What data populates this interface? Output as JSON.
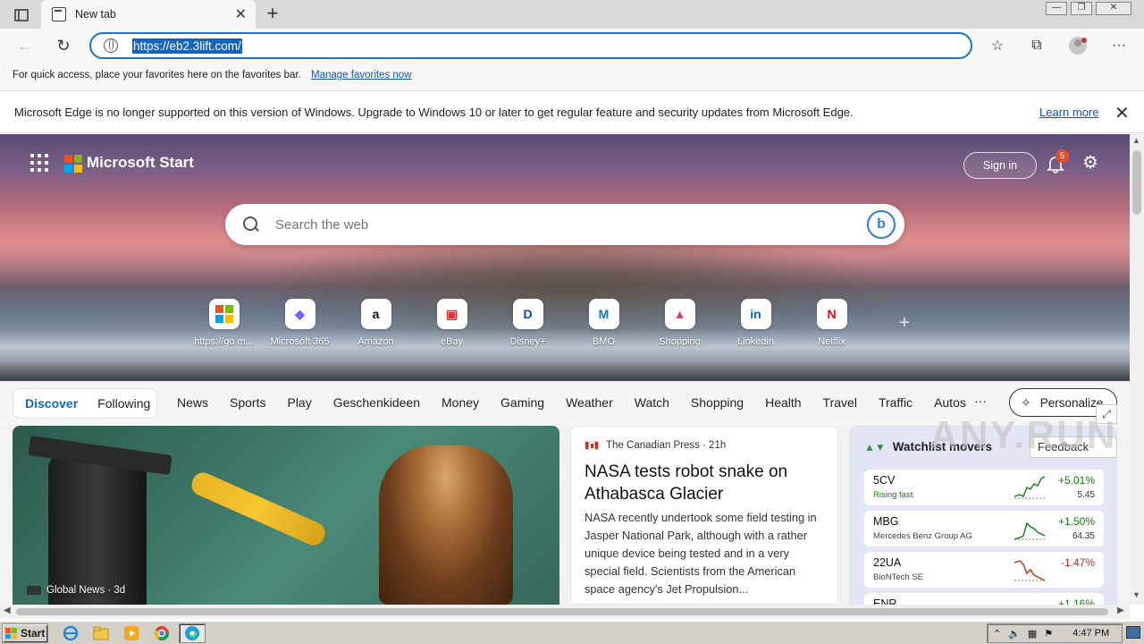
{
  "browser": {
    "tab_title": "New tab",
    "address_url": "https://eb2.3lift.com/",
    "favorites_bar_text": "For quick access, place your favorites here on the favorites bar.",
    "favorites_bar_link": "Manage favorites now",
    "infobar_text": "Microsoft Edge is no longer supported on this version of Windows. Upgrade to Windows 10 or later to get regular feature and security updates from Microsoft Edge.",
    "infobar_link": "Learn more"
  },
  "start": {
    "brand": "Microsoft Start",
    "sign_in": "Sign in",
    "notification_count": "5",
    "search_placeholder": "Search the web",
    "bing_label": "b",
    "quick_links": [
      {
        "label": "https://go.m...",
        "glyph": "",
        "color": "#f25022"
      },
      {
        "label": "Microsoft 365",
        "glyph": "◆",
        "color": "#7b61ff"
      },
      {
        "label": "Amazon",
        "glyph": "a",
        "color": "#111111"
      },
      {
        "label": "eBay",
        "glyph": "▣",
        "color": "#e53238"
      },
      {
        "label": "Disney+",
        "glyph": "D",
        "color": "#113ccf"
      },
      {
        "label": "BMO",
        "glyph": "M",
        "color": "#0079c1"
      },
      {
        "label": "Shopping",
        "glyph": "▲",
        "color": "#e9356e"
      },
      {
        "label": "Linkedin",
        "glyph": "in",
        "color": "#0a66c2"
      },
      {
        "label": "Netflix",
        "glyph": "N",
        "color": "#e50914"
      }
    ]
  },
  "feed_nav": {
    "discover": "Discover",
    "following": "Following",
    "tabs": [
      "News",
      "Sports",
      "Play",
      "Geschenkideen",
      "Money",
      "Gaming",
      "Weather",
      "Watch",
      "Shopping",
      "Health",
      "Travel",
      "Traffic",
      "Autos"
    ],
    "more": "···",
    "personalize": "Personalize"
  },
  "hero_card": {
    "source": "Global News · 3d"
  },
  "news_card": {
    "source": "The Canadian Press · 21h",
    "title": "NASA tests robot snake on Athabasca Glacier",
    "body": "NASA recently undertook some field testing in Jasper National Park, although with a rather unique device being tested and in a very special field. Scientists from the American space agency's Jet Propulsion..."
  },
  "watchlist": {
    "title": "Watchlist movers",
    "more": "···",
    "rows": [
      {
        "symbol": "5CV",
        "name": "Rising fast",
        "change": "+5.01%",
        "value": "5.45",
        "direction": "up"
      },
      {
        "symbol": "MBG",
        "name": "Mercedes Benz Group AG",
        "change": "+1.50%",
        "value": "64.35",
        "direction": "up"
      },
      {
        "symbol": "22UA",
        "name": "BioNTech SE",
        "change": "-1.47%",
        "value": "",
        "direction": "down"
      },
      {
        "symbol": "ENR",
        "name": "",
        "change": "+1.16%",
        "value": "",
        "direction": "up"
      }
    ]
  },
  "overlay": {
    "feedback": "Feedback",
    "watermark": "ANY.RUN"
  },
  "taskbar": {
    "start": "Start",
    "clock": "4:47 PM"
  }
}
